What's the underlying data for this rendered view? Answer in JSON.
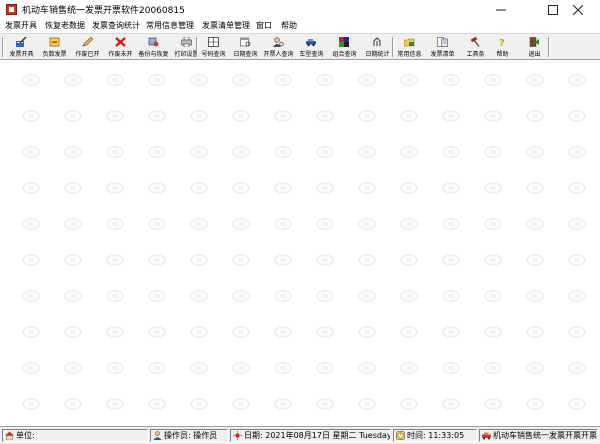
{
  "window": {
    "title": "机动车销售统一发票开票软件20060815",
    "minimize_icon": "minimize-icon",
    "maximize_icon": "maximize-icon",
    "close_icon": "close-icon"
  },
  "menu": {
    "items": [
      {
        "label": "发票开具"
      },
      {
        "label": "恢复老数据"
      },
      {
        "label": "发票查询统计"
      },
      {
        "label": "常用信息管理"
      },
      {
        "label": "发票清单管理"
      },
      {
        "label": "窗口"
      },
      {
        "label": "帮助"
      }
    ]
  },
  "toolbar": {
    "buttons": [
      {
        "label": "发票开具",
        "icon": "invoice-pen-icon"
      },
      {
        "label": "负数发票",
        "icon": "negative-invoice-icon"
      },
      {
        "label": "作废已开",
        "icon": "pencil-icon"
      },
      {
        "label": "作废未开",
        "icon": "red-x-icon"
      },
      {
        "label": "备份与恢复",
        "icon": "backup-icon"
      },
      {
        "label": "打印设置",
        "icon": "printer-icon"
      },
      {
        "label": "号码查询",
        "icon": "number-grid-icon"
      },
      {
        "label": "日期查询",
        "icon": "calendar-search-icon"
      },
      {
        "label": "开票人查询",
        "icon": "person-search-icon"
      },
      {
        "label": "车型查询",
        "icon": "car-search-icon"
      },
      {
        "label": "组合查询",
        "icon": "combo-search-icon"
      },
      {
        "label": "日期统计",
        "icon": "date-stats-icon"
      },
      {
        "label": "常用信息",
        "icon": "info-folder-icon"
      },
      {
        "label": "发票清单",
        "icon": "invoice-list-icon"
      },
      {
        "label": "工具条",
        "icon": "toolbar-hammer-icon"
      },
      {
        "label": "帮助",
        "icon": "help-icon"
      },
      {
        "label": "退出",
        "icon": "exit-door-icon"
      }
    ]
  },
  "statusbar": {
    "unit": "单位:",
    "operator": "操作员: 操作员",
    "date": "日期: 2021年08月17日 星期二 Tuesday",
    "time": "时间: 11:33:05",
    "software": "机动车销售统一发票开票开票软件"
  },
  "colors": {
    "toolbar_bg": "#f0f0f0",
    "status_bg": "#f0f0f0",
    "title_icon": "#c0392b"
  }
}
